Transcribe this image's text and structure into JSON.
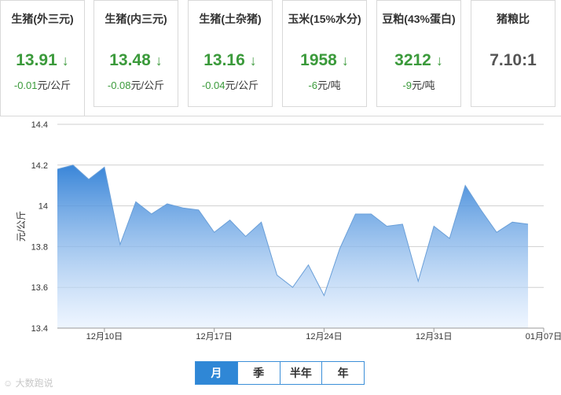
{
  "cards": [
    {
      "title": "生猪(外三元)",
      "value": "13.91",
      "arrow": "↓",
      "change": "-0.01",
      "unit": "元/公斤"
    },
    {
      "title": "生猪(内三元)",
      "value": "13.48",
      "arrow": "↓",
      "change": "-0.08",
      "unit": "元/公斤"
    },
    {
      "title": "生猪(土杂猪)",
      "value": "13.16",
      "arrow": "↓",
      "change": "-0.04",
      "unit": "元/公斤"
    },
    {
      "title": "玉米(15%水分)",
      "value": "1958",
      "arrow": "↓",
      "change": "-6",
      "unit": "元/吨"
    },
    {
      "title": "豆粕(43%蛋白)",
      "value": "3212",
      "arrow": "↓",
      "change": "-9",
      "unit": "元/吨"
    }
  ],
  "ratio_card": {
    "title": "猪粮比",
    "value": "7.10:1"
  },
  "tabs": [
    "月",
    "季",
    "半年",
    "年"
  ],
  "selected_tab": "月",
  "watermark": "大数跑说",
  "colors": {
    "down": "#3b9a3b",
    "accent": "#2f87d6",
    "area_top": "#2f7fd6",
    "area_bottom": "#e3efff"
  },
  "chart_data": {
    "type": "area",
    "title": "",
    "xlabel": "",
    "ylabel": "元/公斤",
    "ylim": [
      13.4,
      14.4
    ],
    "yticks": [
      "14.4",
      "14.2",
      "14",
      "13.8",
      "13.6",
      "13.4"
    ],
    "xticks": [
      {
        "label": "12月10日",
        "day": 3
      },
      {
        "label": "12月17日",
        "day": 10
      },
      {
        "label": "12月24日",
        "day": 17
      },
      {
        "label": "12月31日",
        "day": 24
      },
      {
        "label": "01月07日",
        "day": 31
      }
    ],
    "grid": true,
    "x": [
      0,
      1,
      2,
      3,
      4,
      5,
      6,
      7,
      8,
      9,
      10,
      11,
      12,
      13,
      14,
      15,
      16,
      17,
      18,
      19,
      20,
      21,
      22,
      23,
      24,
      25,
      26,
      27,
      28,
      29,
      30
    ],
    "values": [
      14.18,
      14.2,
      14.13,
      14.19,
      13.81,
      14.02,
      13.96,
      14.01,
      13.99,
      13.98,
      13.87,
      13.93,
      13.85,
      13.92,
      13.66,
      13.6,
      13.71,
      13.56,
      13.79,
      13.96,
      13.96,
      13.9,
      13.91,
      13.63,
      13.9,
      13.84,
      14.1,
      13.98,
      13.87,
      13.92,
      13.91
    ]
  }
}
